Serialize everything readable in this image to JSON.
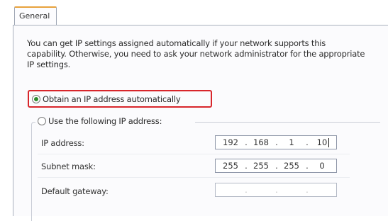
{
  "tabs": [
    {
      "label": "General"
    }
  ],
  "description": "You can get IP settings assigned automatically if your network supports this capability. Otherwise, you need to ask your network administrator for the appropriate IP settings.",
  "options": {
    "auto_label": "Obtain an IP address automatically",
    "auto_selected": true,
    "manual_label": "Use the following IP address:",
    "manual_selected": false,
    "highlight_color": "#d8262b"
  },
  "fields": {
    "ip_address": {
      "label": "IP address:",
      "octets": [
        "192",
        "168",
        "1",
        "10"
      ]
    },
    "subnet_mask": {
      "label": "Subnet mask:",
      "octets": [
        "255",
        "255",
        "255",
        "0"
      ]
    },
    "default_gateway": {
      "label": "Default gateway:",
      "octets": [
        "",
        "",
        "",
        ""
      ]
    }
  }
}
